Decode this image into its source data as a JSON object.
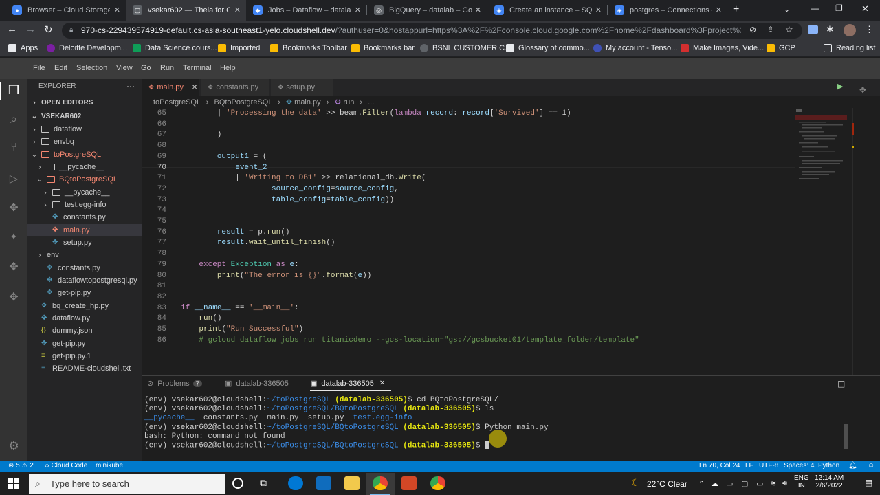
{
  "browser": {
    "tabs": [
      {
        "label": "Browser – Cloud Storage – ",
        "active": false
      },
      {
        "label": "vsekar602 — Theia for Clou",
        "active": true
      },
      {
        "label": "Jobs – Dataflow – datalab -",
        "active": false
      },
      {
        "label": "BigQuery – datalab – Goog",
        "active": false
      },
      {
        "label": "Create an instance – SQL –",
        "active": false
      },
      {
        "label": "postgres – Connections – S",
        "active": false
      }
    ],
    "url_host": "970-cs-229439574919-default.cs-asia-southeast1-yelo.cloudshell.dev",
    "url_rest": "/?authuser=0&hostappurl=https%3A%2F%2Fconsole.cloud.google.com%2Fhome%2Fdashboard%3Fproject%3Ddat...",
    "bookmarks": [
      "Apps",
      "Deloitte Developm...",
      "Data Science cours...",
      "Imported",
      "Bookmarks Toolbar",
      "Bookmarks bar",
      "BSNL CUSTOMER C...",
      "Glossary of commo...",
      "My account - Tenso...",
      "Make Images, Vide...",
      "GCP"
    ],
    "reading_list": "Reading list"
  },
  "menu": [
    "File",
    "Edit",
    "Selection",
    "View",
    "Go",
    "Run",
    "Terminal",
    "Help"
  ],
  "explorer": {
    "title": "EXPLORER",
    "open_editors": "OPEN EDITORS",
    "root": "VSEKAR602",
    "items": [
      "dataflow",
      "envbq",
      "toPostgreSQL",
      "__pycache__",
      "BQtoPostgreSQL",
      "__pycache__",
      "test.egg-info",
      "constants.py",
      "main.py",
      "setup.py",
      "env",
      "constants.py",
      "dataflowtopostgresql.py",
      "get-pip.py",
      "bq_create_hp.py",
      "dataflow.py",
      "dummy.json",
      "get-pip.py",
      "get-pip.py.1",
      "README-cloudshell.txt"
    ]
  },
  "editor": {
    "tabs": [
      "main.py",
      "constants.py",
      "setup.py"
    ],
    "breadcrumbs": [
      "toPostgreSQL",
      "BQtoPostgreSQL",
      "main.py",
      "run",
      "..."
    ],
    "lines": [
      {
        "n": "65",
        "t": "        | 'Processing the data' >> beam.Filter(lambda record: record['Survived'] == 1)"
      },
      {
        "n": "66",
        "t": ""
      },
      {
        "n": "67",
        "t": "        )"
      },
      {
        "n": "68",
        "t": ""
      },
      {
        "n": "69",
        "t": "        output1 = ("
      },
      {
        "n": "70",
        "t": "            event_2"
      },
      {
        "n": "71",
        "t": "            | 'Writing to DB1' >> relational_db.Write("
      },
      {
        "n": "72",
        "t": "                    source_config=source_config,"
      },
      {
        "n": "73",
        "t": "                    table_config=table_config))"
      },
      {
        "n": "74",
        "t": ""
      },
      {
        "n": "75",
        "t": ""
      },
      {
        "n": "76",
        "t": "        result = p.run()"
      },
      {
        "n": "77",
        "t": "        result.wait_until_finish()"
      },
      {
        "n": "78",
        "t": ""
      },
      {
        "n": "79",
        "t": "    except Exception as e:"
      },
      {
        "n": "80",
        "t": "        print(\"The error is {}\".format(e))"
      },
      {
        "n": "81",
        "t": ""
      },
      {
        "n": "82",
        "t": ""
      },
      {
        "n": "83",
        "t": "if __name__ == '__main__':"
      },
      {
        "n": "84",
        "t": "    run()"
      },
      {
        "n": "85",
        "t": "    print(\"Run Successful\")"
      },
      {
        "n": "86",
        "t": "    # gcloud dataflow jobs run titanicdemo --gcs-location=\"gs://gcsbucket01/template_folder/template\""
      }
    ]
  },
  "panel": {
    "problems_label": "Problems",
    "problems_count": "7",
    "tab1": "datalab-336505",
    "tab2": "datalab-336505"
  },
  "terminal": {
    "prompt_env": "(env) ",
    "user": "vsekar602@cloudshell",
    "path1": "~/toPostgreSQL",
    "path2": "~/toPostgreSQL/BQtoPostgreSQL",
    "project": "(datalab-336505)",
    "cmd1": "cd BQtoPostgreSQL/",
    "cmd2": "ls",
    "ls_dir1": "__pycache__",
    "ls_files": "  constants.py  main.py  setup.py  ",
    "ls_dir2": "test.egg-info",
    "cmd3": "Python main.py",
    "error": "bash: Python: command not found"
  },
  "status": {
    "errors": "5",
    "warnings": "2",
    "cloud_code": "Cloud Code",
    "minikube": "minikube",
    "position": "Ln 70, Col 24",
    "eol": "LF",
    "encoding": "UTF-8",
    "indent": "Spaces: 4",
    "language": "Python"
  },
  "taskbar": {
    "search_placeholder": "Type here to search",
    "weather": "22°C  Clear",
    "lang1": "ENG",
    "lang2": "IN",
    "time": "12:14 AM",
    "date": "2/6/2022"
  }
}
